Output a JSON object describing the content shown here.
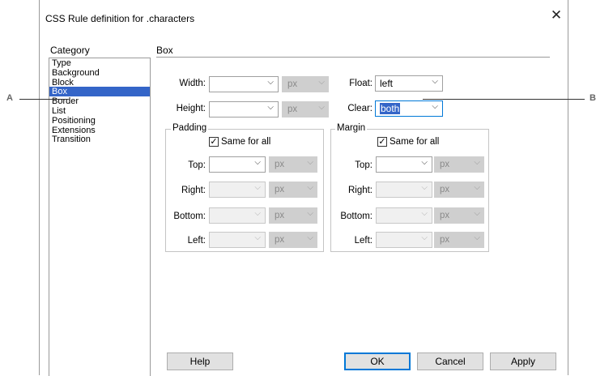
{
  "dialog": {
    "title": "CSS Rule definition for .characters",
    "close_glyph": "✕"
  },
  "category": {
    "label": "Category",
    "items": [
      "Type",
      "Background",
      "Block",
      "Box",
      "Border",
      "List",
      "Positioning",
      "Extensions",
      "Transition"
    ],
    "selected": "Box"
  },
  "section": "Box",
  "width": {
    "label": "Width:",
    "value": "",
    "unit": "px"
  },
  "height": {
    "label": "Height:",
    "value": "",
    "unit": "px"
  },
  "float": {
    "label": "Float:",
    "value": "left"
  },
  "clear": {
    "label": "Clear:",
    "value": "both"
  },
  "padding": {
    "title": "Padding",
    "same_label": "Same for all",
    "same_checked": true,
    "top": {
      "label": "Top:",
      "value": "",
      "unit": "px"
    },
    "right": {
      "label": "Right:",
      "value": "",
      "unit": "px"
    },
    "bottom": {
      "label": "Bottom:",
      "value": "",
      "unit": "px"
    },
    "left": {
      "label": "Left:",
      "value": "",
      "unit": "px"
    }
  },
  "margin": {
    "title": "Margin",
    "same_label": "Same for all",
    "same_checked": true,
    "top": {
      "label": "Top:",
      "value": "",
      "unit": "px"
    },
    "right": {
      "label": "Right:",
      "value": "",
      "unit": "px"
    },
    "bottom": {
      "label": "Bottom:",
      "value": "",
      "unit": "px"
    },
    "left": {
      "label": "Left:",
      "value": "",
      "unit": "px"
    }
  },
  "buttons": {
    "help": "Help",
    "ok": "OK",
    "cancel": "Cancel",
    "apply": "Apply"
  },
  "callouts": {
    "a": "A",
    "b": "B"
  },
  "glyphs": {
    "dropdown": "⌵",
    "check": "✓"
  }
}
